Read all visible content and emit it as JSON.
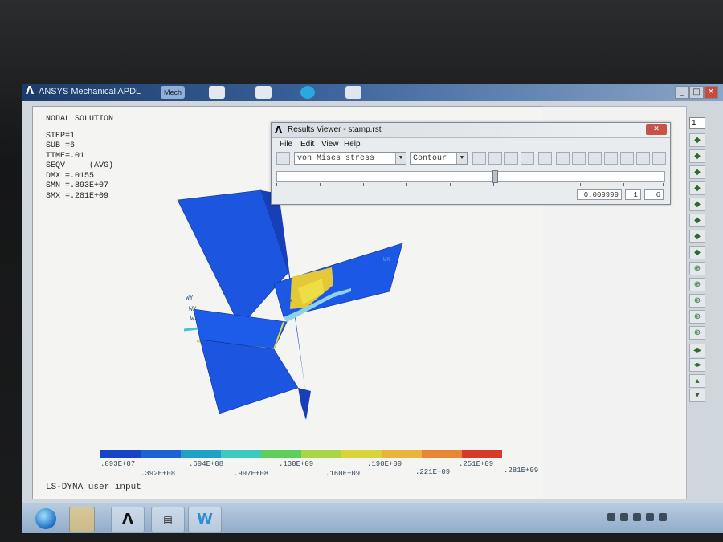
{
  "app": {
    "title": "ANSYS Mechanical APDL",
    "menu_hint": "Mech"
  },
  "nodal_solution": {
    "heading": "NODAL SOLUTION",
    "lines": [
      "STEP=1",
      "SUB =6",
      "TIME=.01",
      "SEQV     (AVG)",
      "DMX =.0155",
      "SMN =.893E+07",
      "SMX =.281E+09"
    ]
  },
  "model_labels": {
    "wy": "WY",
    "wx": "WX",
    "wx2": "WX",
    "mx": "MX",
    "wx_tag": "WX"
  },
  "legend": {
    "colors": [
      "#1644c8",
      "#1a62d6",
      "#1fa0c6",
      "#3ec9c0",
      "#5fcf5c",
      "#a8d646",
      "#d9d43c",
      "#e8b43a",
      "#e88634",
      "#d83a2a"
    ],
    "labels_top": [
      ".893E+07",
      ".694E+08",
      ".130E+09",
      ".190E+09",
      ".251E+09"
    ],
    "labels_bottom": [
      ".392E+08",
      ".997E+08",
      ".160E+09",
      ".221E+09",
      ".281E+09"
    ]
  },
  "status_line": "LS-DYNA user input",
  "results_viewer": {
    "title": "Results Viewer - stamp.rst",
    "close": "✕",
    "menu": [
      "File",
      "Edit",
      "View",
      "Help"
    ],
    "result_item": "von Mises stress",
    "display_type": "Contour",
    "time_value": "0.009999",
    "load_step": "1",
    "substep": "6"
  },
  "side_toolbar": {
    "view_select": "1"
  },
  "colors": {
    "model_blue": "#1a4fd8",
    "titlebar": "#2a4d82"
  }
}
